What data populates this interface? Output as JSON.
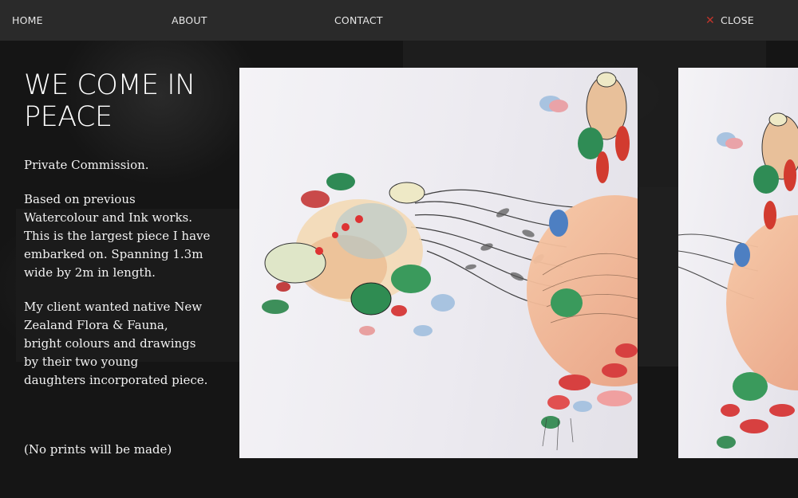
{
  "nav": {
    "home": "HOME",
    "about": "ABOUT",
    "contact": "CONTACT",
    "close": "CLOSE"
  },
  "icons": {
    "close": "close-icon"
  },
  "colors": {
    "accent": "#c2352b",
    "nav_bg": "#2a2a2a",
    "page_bg": "#141414"
  },
  "artwork": {
    "title_line1": "WE COME IN",
    "title_line2": "PEACE",
    "subtitle": "Private Commission.",
    "para1": [
      "Based on previous",
      "Watercolour and Ink works.",
      "This is the largest piece I have",
      "embarked on. Spanning 1.3m",
      "wide by 2m in length."
    ],
    "para2": [
      "My client wanted native New",
      "Zealand Flora & Fauna,",
      "bright colours and drawings",
      "by their two young",
      "daughters incorporated piece."
    ],
    "note": "(No prints will be made)"
  }
}
